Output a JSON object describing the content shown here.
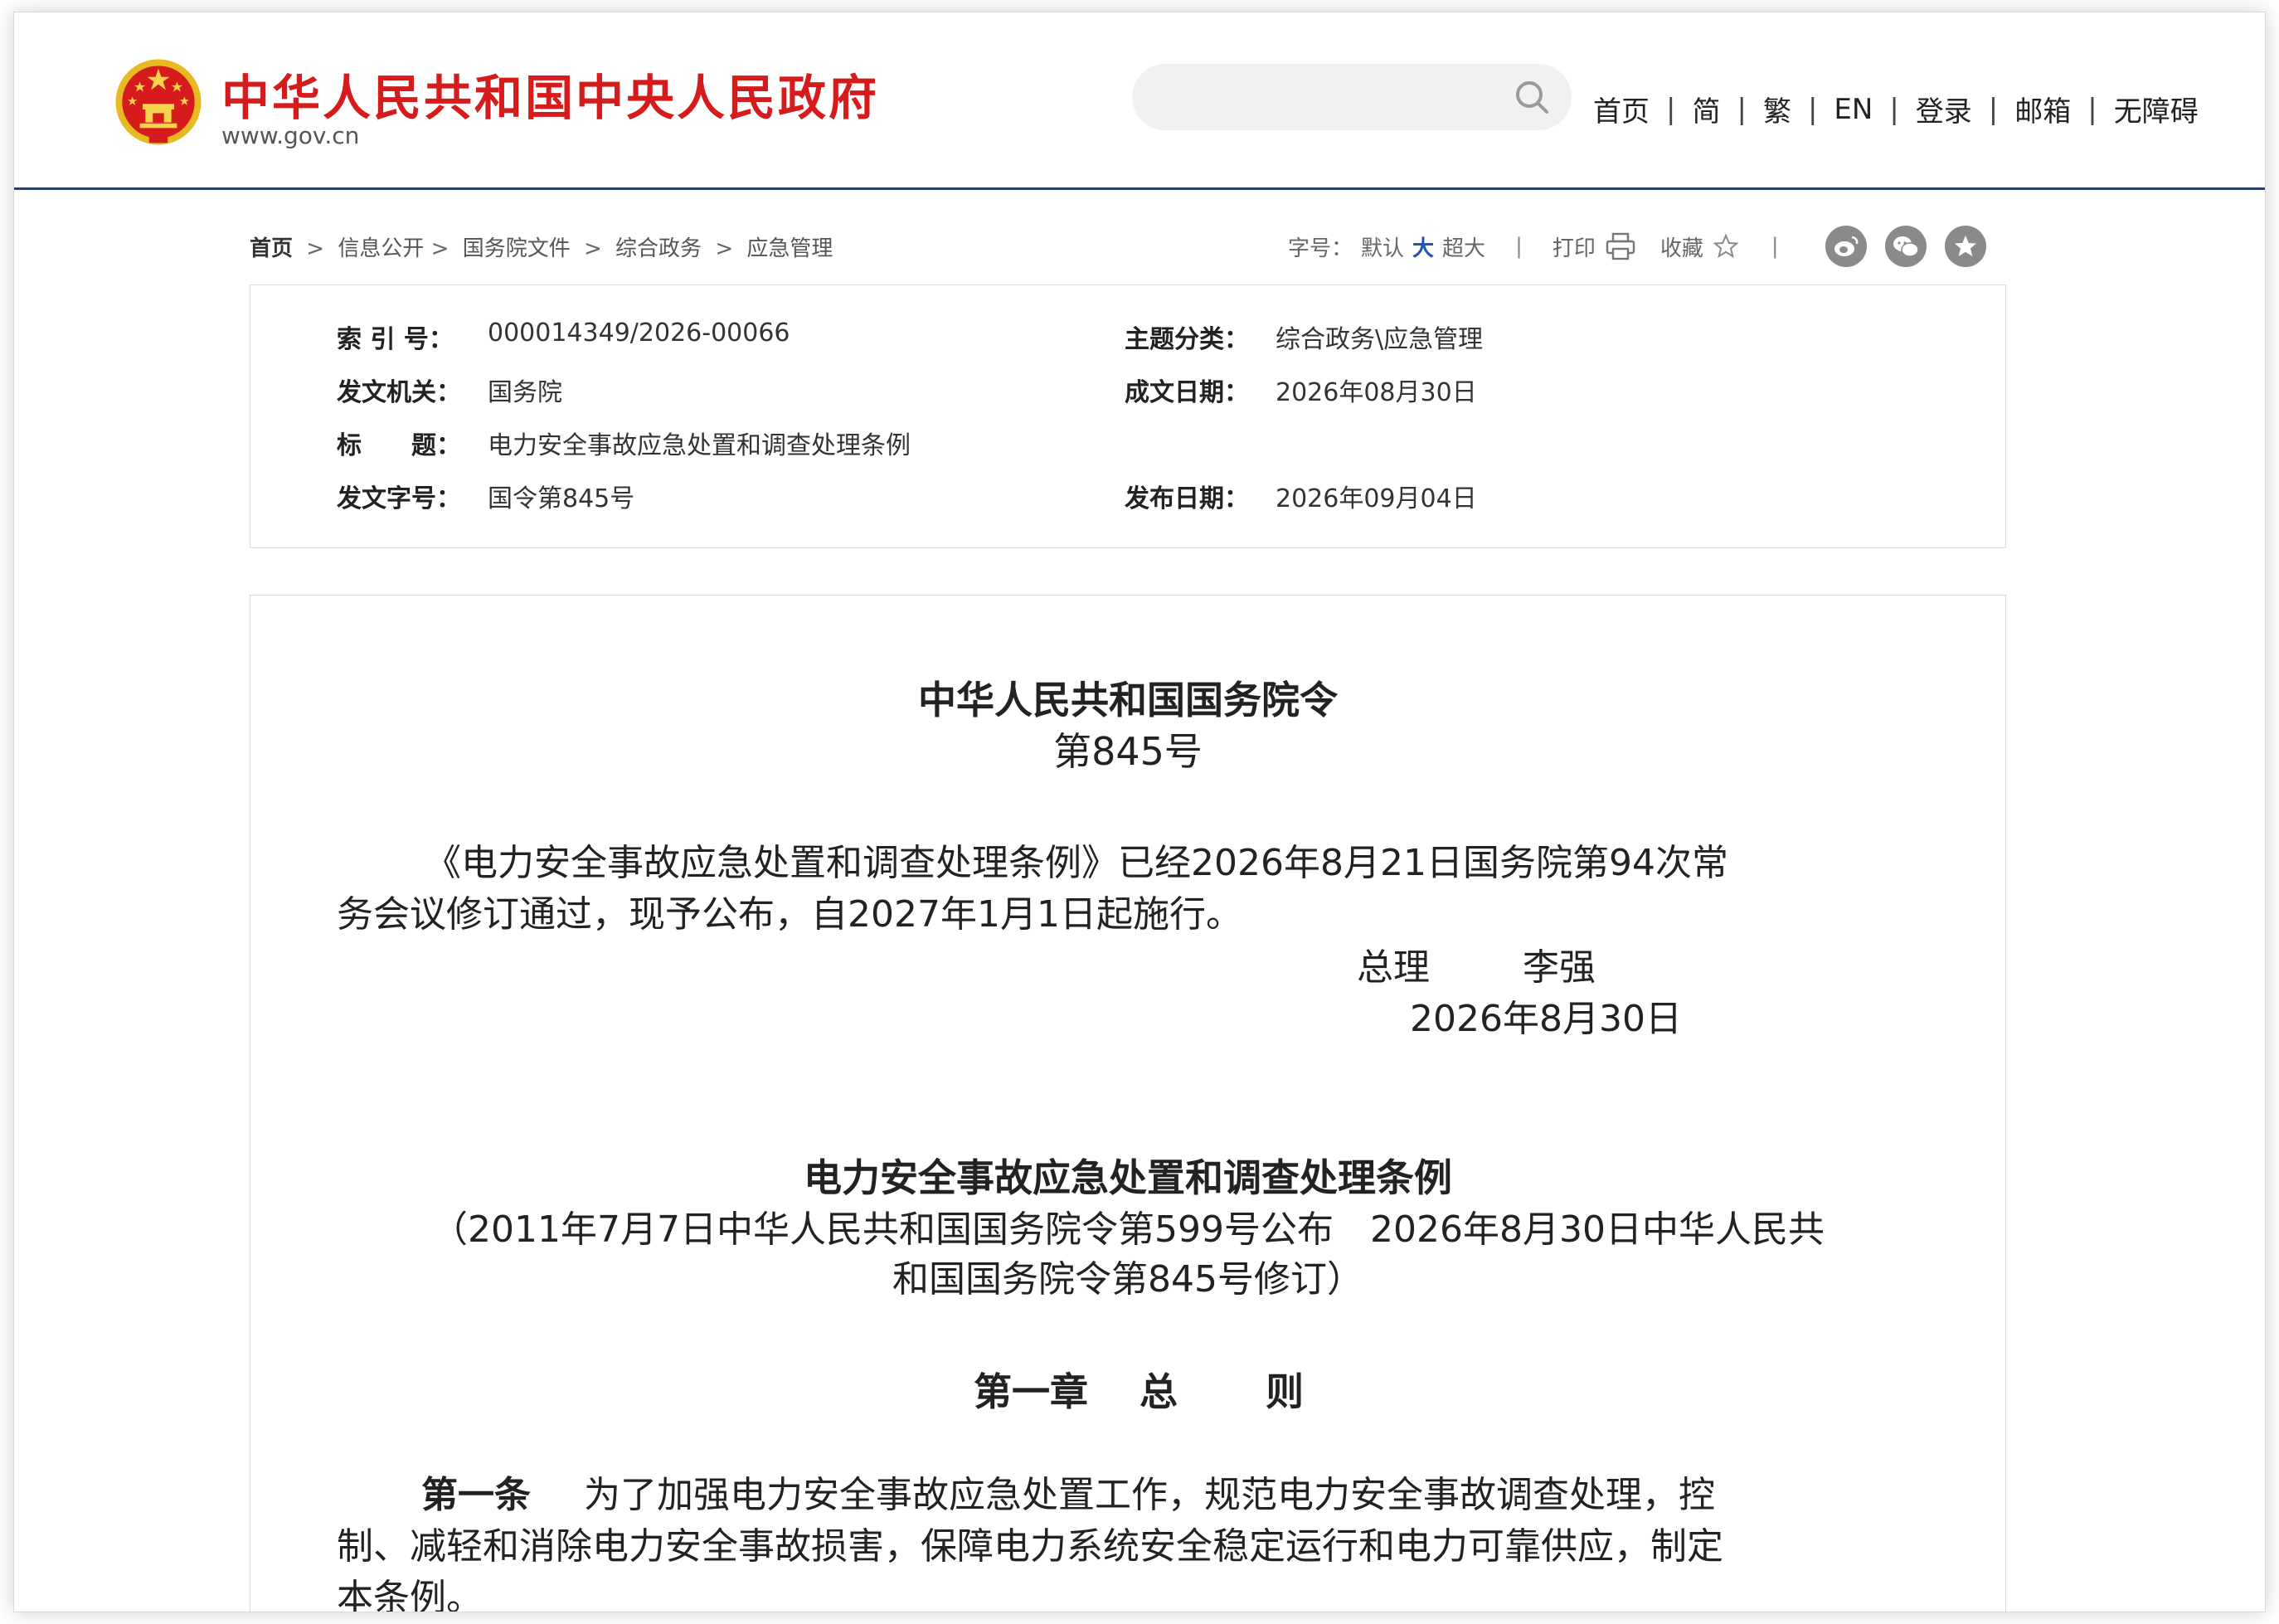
{
  "header": {
    "site_title": "中华人民共和国中央人民政府",
    "site_url": "www.gov.cn",
    "search_placeholder": "",
    "nav": [
      "首页",
      "简",
      "繁",
      "EN",
      "登录",
      "邮箱",
      "无障碍"
    ],
    "nav_separator": "|"
  },
  "breadcrumb": {
    "home": "首页",
    "items": [
      "信息公开",
      "国务院文件",
      "综合政务",
      "应急管理"
    ],
    "separator": ">"
  },
  "tools": {
    "font_label": "字号：",
    "font_default": "默认",
    "font_large": "大",
    "font_xlarge": "超大",
    "print": "打印",
    "favorite": "收藏",
    "separator": "|",
    "share_icons": [
      "weibo-icon",
      "wechat-icon",
      "star-circle-icon"
    ]
  },
  "meta": {
    "index_key": "索 引 号：",
    "index_val": "000014349/2026-00066",
    "topic_key": "主题分类：",
    "topic_val": "综合政务\\应急管理",
    "issuer_key": "发文机关：",
    "issuer_val": "国务院",
    "written_key": "成文日期：",
    "written_val": "2026年08月30日",
    "title_key": "标　　题：",
    "title_val": "电力安全事故应急处置和调查处理条例",
    "docno_key": "发文字号：",
    "docno_val": "国令第845号",
    "published_key": "发布日期：",
    "published_val": "2026年09月04日"
  },
  "article": {
    "decree_title": "中华人民共和国国务院令",
    "decree_no": "第845号",
    "body_line1": "《电力安全事故应急处置和调查处理条例》已经2026年8月21日国务院第94次常",
    "body_line2": "务会议修订通过，现予公布，自2027年1月1日起施行。",
    "signer_title": "总理",
    "signer_name": "李强",
    "sign_date": "2026年8月30日",
    "reg_title": "电力安全事故应急处置和调查处理条例",
    "reg_note_line1": "（2011年7月7日中华人民共和国国务院令第599号公布　2026年8月30日中华人民共",
    "reg_note_line2": "和国国务院令第845号修订）",
    "chapter_no": "第一章",
    "chapter_name_1": "总",
    "chapter_name_2": "则",
    "art1_label": "第一条",
    "art1_line1": "为了加强电力安全事故应急处置工作，规范电力安全事故调查处理，控",
    "art1_line2": "制、减轻和消除电力安全事故损害，保障电力系统安全稳定运行和电力可靠供应，制定",
    "art1_line3": "本条例。"
  },
  "colors": {
    "brand_red": "#d51b1b",
    "header_rule": "#27406b",
    "active_blue": "#1d54b5"
  }
}
